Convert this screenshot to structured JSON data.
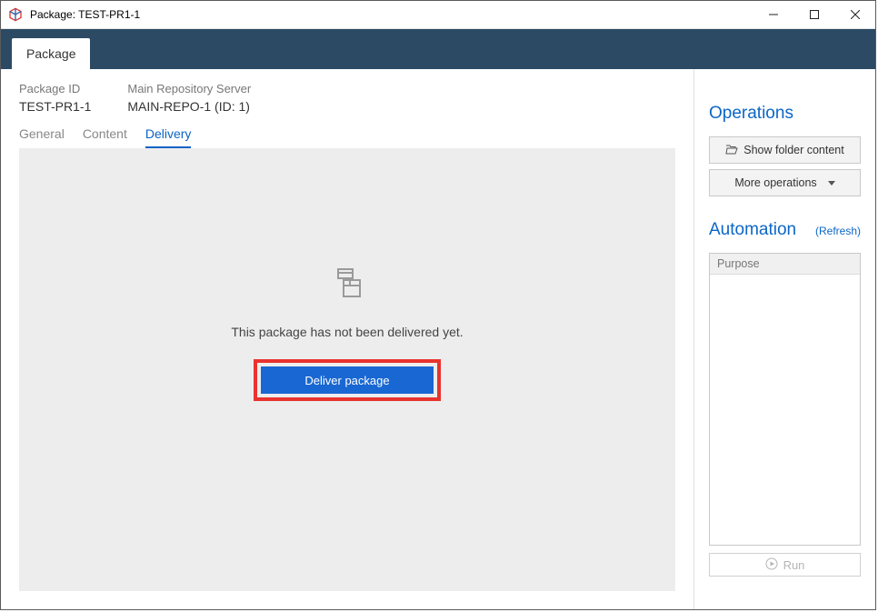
{
  "window": {
    "title": "Package: TEST-PR1-1"
  },
  "nav": {
    "tab": "Package"
  },
  "properties": {
    "package_id_label": "Package ID",
    "package_id_value": "TEST-PR1-1",
    "repo_label": "Main Repository Server",
    "repo_value": "MAIN-REPO-1 (ID: 1)"
  },
  "subtabs": {
    "general": "General",
    "content": "Content",
    "delivery": "Delivery",
    "active": "delivery"
  },
  "delivery": {
    "empty_text": "This package has not been delivered yet.",
    "button_label": "Deliver package"
  },
  "side": {
    "operations_title": "Operations",
    "show_folder": "Show folder content",
    "more_ops": "More operations",
    "automation_title": "Automation",
    "refresh": "(Refresh)",
    "purpose_header": "Purpose",
    "run_label": "Run"
  }
}
